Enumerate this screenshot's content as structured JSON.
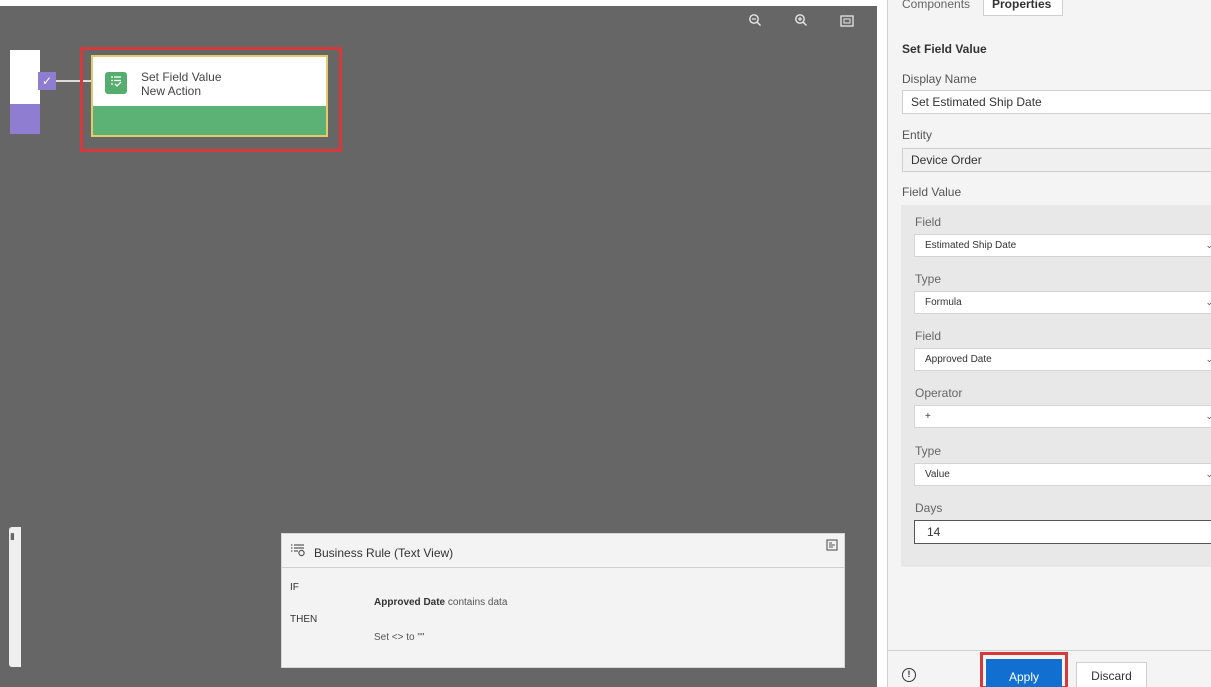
{
  "canvas": {
    "toolbar": {
      "zoom_out_icon": "zoom-out-icon",
      "zoom_in_icon": "zoom-in-icon",
      "fit_icon": "fit-to-screen-icon"
    },
    "action_node": {
      "title": "Set Field Value",
      "subtitle": "New Action"
    }
  },
  "text_view": {
    "title": "Business Rule (Text View)",
    "if_label": "IF",
    "condition_field": "Approved Date",
    "condition_rest": " contains data",
    "then_label": "THEN",
    "action_text": "Set <> to \"\""
  },
  "panel": {
    "tabs": [
      {
        "label": "Components",
        "active": false
      },
      {
        "label": "Properties",
        "active": true
      }
    ],
    "section_title": "Set Field Value",
    "display_name_label": "Display Name",
    "display_name_value": "Set Estimated Ship Date",
    "entity_label": "Entity",
    "entity_value": "Device Order",
    "field_value_label": "Field Value",
    "field_value": {
      "field_label": "Field",
      "field_value": "Estimated Ship Date",
      "type_label": "Type",
      "type_value": "Formula",
      "field2_label": "Field",
      "field2_value": "Approved Date",
      "operator_label": "Operator",
      "operator_value": "+",
      "type2_label": "Type",
      "type2_value": "Value",
      "days_label": "Days",
      "days_value": "14"
    },
    "footer": {
      "apply_label": "Apply",
      "discard_label": "Discard"
    }
  },
  "colors": {
    "canvas_bg": "#666666",
    "action_green": "#5bb274",
    "condition_purple": "#8f7dd1",
    "highlight_red": "#d7393a",
    "apply_blue": "#1170cf"
  }
}
